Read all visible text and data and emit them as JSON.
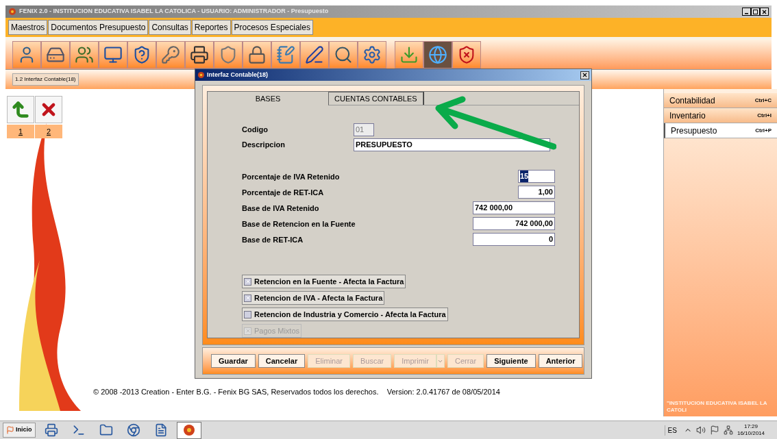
{
  "window": {
    "title": "FENIX 2.0 - INSTITUCION EDUCATIVA ISABEL LA CATOLICA - USUARIO: ADMINISTRADOR  - Presupuesto"
  },
  "menu": [
    "Maestros",
    "Documentos Presupuesto",
    "Consultas",
    "Reportes",
    "Procesos Especiales"
  ],
  "open_tabs": [
    {
      "label": "1.2 Interfaz Contable(18)",
      "selected": true
    }
  ],
  "left_actions": [
    {
      "kind": "accept",
      "label": "1"
    },
    {
      "kind": "cancel",
      "label": "2"
    }
  ],
  "right_menu": [
    {
      "label": "Contabilidad",
      "shortcut": "Ctrl+C",
      "selected": false
    },
    {
      "label": "Inventario",
      "shortcut": "Ctrl+I",
      "selected": false
    },
    {
      "label": "Presupuesto",
      "shortcut": "Ctrl+P",
      "selected": true
    }
  ],
  "right_panel_caption": "\"INSTITUCION EDUCATIVA ISABEL LA CATOLI",
  "dialog": {
    "title": "Interfaz Contable(18)",
    "tabs": [
      {
        "label": "BASES",
        "selected": true
      },
      {
        "label": "CUENTAS CONTABLES",
        "selected": false
      }
    ],
    "fields": [
      {
        "kind": "code",
        "label": "Codigo",
        "value": "01",
        "disabled": true,
        "right_aligned": false,
        "highlighted": false
      },
      {
        "kind": "text",
        "label": "Descripcion",
        "value": "PRESUPUESTO",
        "disabled": false,
        "right_aligned": false,
        "highlighted": false
      },
      {
        "kind": "percent",
        "label": "Porcentaje de IVA Retenido",
        "value": "15",
        "disabled": false,
        "right_aligned": false,
        "highlighted": true
      },
      {
        "kind": "percent",
        "label": "Porcentaje de RET-ICA",
        "value": "1,00",
        "disabled": false,
        "right_aligned": true,
        "highlighted": false
      },
      {
        "kind": "amount",
        "label": "Base de IVA Retenido",
        "value": "742 000,00",
        "disabled": false,
        "right_aligned": false,
        "highlighted": false
      },
      {
        "kind": "amount",
        "label": "Base de Retencion en la Fuente",
        "value": "742 000,00",
        "disabled": false,
        "right_aligned": true,
        "highlighted": false
      },
      {
        "kind": "amount",
        "label": "Base de RET-ICA",
        "value": "0",
        "disabled": false,
        "right_aligned": true,
        "highlighted": false
      }
    ],
    "checkboxes": [
      {
        "label": "Retencion  en la Fuente - Afecta la Factura",
        "checked": true,
        "disabled": false
      },
      {
        "label": "Retencion  de IVA - Afecta la Factura",
        "checked": true,
        "disabled": false
      },
      {
        "label": "Retencion  de Industria y Comercio - Afecta la Factura",
        "checked": false,
        "disabled": false
      },
      {
        "label": "Pagos Mixtos",
        "checked": true,
        "disabled": true
      }
    ],
    "buttons": [
      {
        "label": "Guardar",
        "disabled": false,
        "has_menu": false
      },
      {
        "label": "Cancelar",
        "disabled": false,
        "has_menu": false
      },
      {
        "label": "Eliminar",
        "disabled": true,
        "has_menu": false
      },
      {
        "label": "Buscar",
        "disabled": true,
        "has_menu": false
      },
      {
        "label": "Imprimir",
        "disabled": true,
        "has_menu": true
      },
      {
        "label": "Cerrar",
        "disabled": true,
        "has_menu": false
      },
      {
        "label": "Siguiente",
        "disabled": false,
        "has_menu": false
      },
      {
        "label": "Anterior",
        "disabled": false,
        "has_menu": false
      }
    ]
  },
  "footer": "© 2008 -2013 Creation - Enter B.G. - Fenix BG SAS, Reservados todos los derechos.    Version: 2.0.41767 de 08/05/2014",
  "taskbar": {
    "start": "Inicio",
    "language": "ES",
    "time": "17:29",
    "date": "16/10/2014"
  }
}
